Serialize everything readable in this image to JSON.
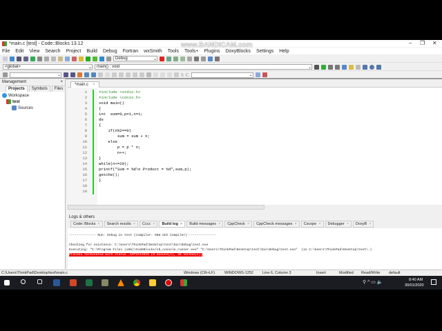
{
  "window": {
    "title": "*main.c [test] - Code::Blocks 13.12",
    "watermark": "www.BANDICAM.com",
    "minimize": "–",
    "maximize": "❐",
    "close": "✕"
  },
  "menu": [
    "File",
    "Edit",
    "View",
    "Search",
    "Project",
    "Build",
    "Debug",
    "Fortran",
    "wxSmith",
    "Tools",
    "Tools+",
    "Plugins",
    "DoxyBlocks",
    "Settings",
    "Help"
  ],
  "toolbar": {
    "build_target": "Debug",
    "scope": "<global>",
    "function": "main() : void",
    "letters": [
      "S",
      "C"
    ]
  },
  "management": {
    "title": "Management",
    "close": "×",
    "tabs": [
      "Projects",
      "Symbols",
      "Files"
    ],
    "tree": {
      "workspace": "Workspace",
      "project": "test",
      "folder": "Sources"
    }
  },
  "editor": {
    "tab": "*main.c",
    "tab_close": "×",
    "lines": [
      "#include <stdio.h>",
      "#include <conio.h>",
      "void main()",
      "{",
      "int  sum=0,p=1,n=1;",
      "do",
      "{",
      "    if(n%2==0)",
      "        sum = sum + n;",
      "    else",
      "        p = p * n;",
      "        n++;",
      "}",
      "while(n<=20);",
      "printf(\"Sum = %d\\n Product = %d\",sum,p);",
      "getche();",
      "}",
      "",
      ""
    ]
  },
  "logs": {
    "title": "Logs & others",
    "tabs": [
      "Code::Blocks",
      "Search results",
      "Cccc",
      "Build log",
      "Build messages",
      "CppCheck",
      "CppCheck messages",
      "Cscope",
      "Debugger",
      "DoxyB"
    ],
    "lines": [
      "-------------- Run: Debug in test (compiler: GNU GCC Compiler)---------------",
      "",
      "Checking for existence: C:\\Users\\ThinkPad\\Desktop\\test\\bin\\Debug\\test.exe",
      "Executing: \"C:\\Program Files (x86)\\CodeBlocks/cb_console_runner.exe\" \"C:\\Users\\ThinkPad\\Desktop\\test\\bin\\Debug\\test.exe\"  (in C:\\Users\\ThinkPad\\Desktop\\test\\.)"
    ],
    "error": "Process terminated with status -1073741510 (0 minute(s), 30 second(s))"
  },
  "status": {
    "path": "C:\\Users\\ThinkPad\\Desktop\\test\\main.c",
    "eol": "Windows (CR+LF)",
    "encoding": "WINDOWS-1252",
    "position": "Line 6, Column 3",
    "mode": "Insert",
    "modified": "Modified",
    "access": "Read/Write",
    "lang": "default"
  },
  "taskbar": {
    "time": "8:40 AM",
    "date": "30/01/2020"
  }
}
